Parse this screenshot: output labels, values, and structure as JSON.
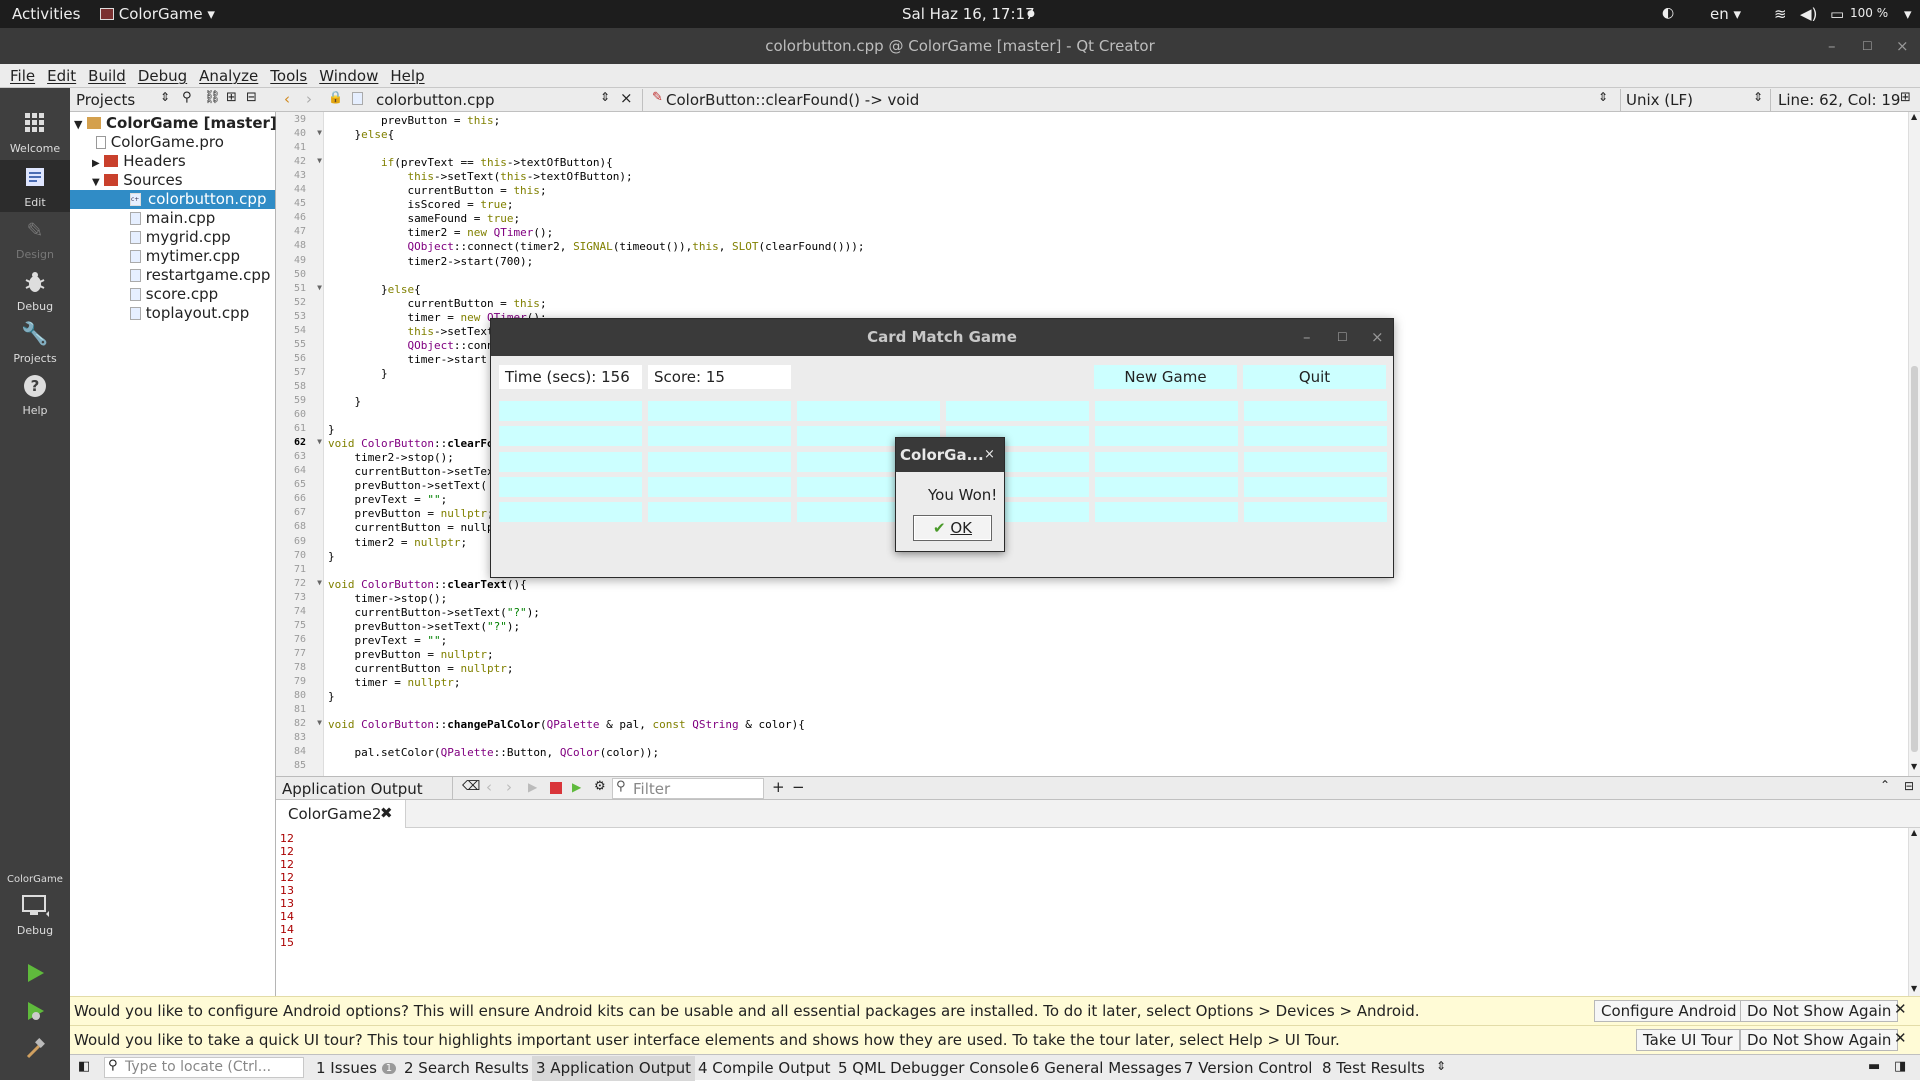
{
  "topbar": {
    "activities": "Activities",
    "app": "ColorGame",
    "datetime": "Sal Haz 16, 17:17",
    "lang": "en",
    "battery": "100 %"
  },
  "window": {
    "title": "colorbutton.cpp @ ColorGame [master] - Qt Creator"
  },
  "menu": [
    "File",
    "Edit",
    "Build",
    "Debug",
    "Analyze",
    "Tools",
    "Window",
    "Help"
  ],
  "modes": {
    "welcome": "Welcome",
    "edit": "Edit",
    "design": "Design",
    "debug": "Debug",
    "projects": "Projects",
    "help": "Help",
    "kit_project": "ColorGame",
    "kit_mode": "Debug"
  },
  "projects": {
    "selector": "Projects",
    "root": "ColorGame [master]",
    "pro": "ColorGame.pro",
    "headers": "Headers",
    "sources": "Sources",
    "files": [
      "colorbutton.cpp",
      "main.cpp",
      "mygrid.cpp",
      "mytimer.cpp",
      "restartgame.cpp",
      "score.cpp",
      "toplayout.cpp"
    ]
  },
  "editor": {
    "file": "colorbutton.cpp",
    "symbol": "ColorButton::clearFound() -> void",
    "encoding": "Unix (LF)",
    "position": "Line: 62, Col: 19"
  },
  "code": [
    {
      "n": "39",
      "t": "        prevButton = this;"
    },
    {
      "n": "40",
      "t": "    }else{"
    },
    {
      "n": "41",
      "t": ""
    },
    {
      "n": "42",
      "t": "        if(prevText == this->textOfButton){"
    },
    {
      "n": "43",
      "t": "            this->setText(this->textOfButton);"
    },
    {
      "n": "44",
      "t": "            currentButton = this;"
    },
    {
      "n": "45",
      "t": "            isScored = true;"
    },
    {
      "n": "46",
      "t": "            sameFound = true;"
    },
    {
      "n": "47",
      "t": "            timer2 = new QTimer();"
    },
    {
      "n": "48",
      "t": "            QObject::connect(timer2, SIGNAL(timeout()),this, SLOT(clearFound()));"
    },
    {
      "n": "49",
      "t": "            timer2->start(700);"
    },
    {
      "n": "50",
      "t": ""
    },
    {
      "n": "51",
      "t": "        }else{"
    },
    {
      "n": "52",
      "t": "            currentButton = this;"
    },
    {
      "n": "53",
      "t": "            timer = new QTimer();"
    },
    {
      "n": "54",
      "t": "            this->setText"
    },
    {
      "n": "55",
      "t": "            QObject::conn"
    },
    {
      "n": "56",
      "t": "            timer->start"
    },
    {
      "n": "57",
      "t": "        }"
    },
    {
      "n": "58",
      "t": ""
    },
    {
      "n": "59",
      "t": "    }"
    },
    {
      "n": "60",
      "t": ""
    },
    {
      "n": "61",
      "t": "}"
    },
    {
      "n": "62",
      "t": "void ColorButton::clearFo"
    },
    {
      "n": "63",
      "t": "    timer2->stop();"
    },
    {
      "n": "64",
      "t": "    currentButton->setTex"
    },
    {
      "n": "65",
      "t": "    prevButton->setText("
    },
    {
      "n": "66",
      "t": "    prevText = \"\";"
    },
    {
      "n": "67",
      "t": "    prevButton = nullptr;"
    },
    {
      "n": "68",
      "t": "    currentButton = nullp"
    },
    {
      "n": "69",
      "t": "    timer2 = nullptr;"
    },
    {
      "n": "70",
      "t": "}"
    },
    {
      "n": "71",
      "t": ""
    },
    {
      "n": "72",
      "t": "void ColorButton::clearText(){"
    },
    {
      "n": "73",
      "t": "    timer->stop();"
    },
    {
      "n": "74",
      "t": "    currentButton->setText(\"?\");"
    },
    {
      "n": "75",
      "t": "    prevButton->setText(\"?\");"
    },
    {
      "n": "76",
      "t": "    prevText = \"\";"
    },
    {
      "n": "77",
      "t": "    prevButton = nullptr;"
    },
    {
      "n": "78",
      "t": "    currentButton = nullptr;"
    },
    {
      "n": "79",
      "t": "    timer = nullptr;"
    },
    {
      "n": "80",
      "t": "}"
    },
    {
      "n": "81",
      "t": ""
    },
    {
      "n": "82",
      "t": "void ColorButton::changePalColor(QPalette & pal, const QString & color){"
    },
    {
      "n": "83",
      "t": ""
    },
    {
      "n": "84",
      "t": "    pal.setColor(QPalette::Button, QColor(color));"
    },
    {
      "n": "85",
      "t": ""
    }
  ],
  "output": {
    "title": "Application Output",
    "filter_placeholder": "Filter",
    "tab": "ColorGame2",
    "lines": [
      "12",
      "12",
      "12",
      "12",
      "13",
      "13",
      "14",
      "14",
      "15"
    ]
  },
  "infobars": [
    {
      "msg": "Would you like to configure Android options? This will ensure Android kits can be usable and all essential packages are installed. To do it later, select Options > Devices > Android.",
      "btn1": "Configure Android",
      "btn2": "Do Not Show Again"
    },
    {
      "msg": "Would you like to take a quick UI tour? This tour highlights important user interface elements and shows how they are used. To take the tour later, select Help > UI Tour.",
      "btn1": "Take UI Tour",
      "btn2": "Do Not Show Again"
    }
  ],
  "statusbar": {
    "locator_placeholder": "Type to locate (Ctrl...",
    "tabs": [
      "1  Issues",
      "2  Search Results",
      "3  Application Output",
      "4  Compile Output",
      "5  QML Debugger Console",
      "6  General Messages",
      "7  Version Control",
      "8  Test Results"
    ],
    "issues_count": "1"
  },
  "game": {
    "title": "Card Match Game",
    "time": "Time (secs): 156",
    "score": "Score: 15",
    "new_game": "New Game",
    "quit": "Quit"
  },
  "dialog": {
    "title": "ColorGa...",
    "message": "You Won!",
    "ok": "OK"
  },
  "colors": {
    "cell": "#ccffff",
    "accent": "#308cc6",
    "output_text": "#aa0000"
  }
}
